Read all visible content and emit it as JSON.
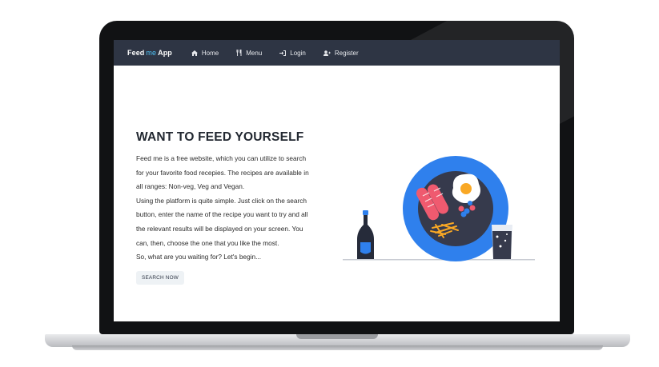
{
  "nav": {
    "brand_prefix": "Feed",
    "brand_me": "me",
    "brand_suffix": "App",
    "items": [
      {
        "label": "Home",
        "icon": "home-icon"
      },
      {
        "label": "Menu",
        "icon": "utensils-icon"
      },
      {
        "label": "Login",
        "icon": "sign-in-icon"
      },
      {
        "label": "Register",
        "icon": "user-plus-icon"
      }
    ]
  },
  "hero": {
    "title": "WANT TO FEED YOURSELF",
    "lines": [
      "Feed me is a free website, which you can utilize to search",
      "for your favorite food recepies. The recipes are available in",
      "all ranges: Non-veg, Veg and Vegan.",
      "Using the platform is quite simple. Just click on the search",
      "button, enter the name of the recipe you want to try and all",
      "the relevant results will be displayed on your screen. You",
      "can, then, choose the one that you like the most.",
      "So, what are you waiting for? Let's begin..."
    ],
    "button_label": "SEARCH NOW"
  },
  "colors": {
    "navbar": "#2e3544",
    "accent": "#2f80ed",
    "brand_highlight": "#4fc3f7"
  }
}
